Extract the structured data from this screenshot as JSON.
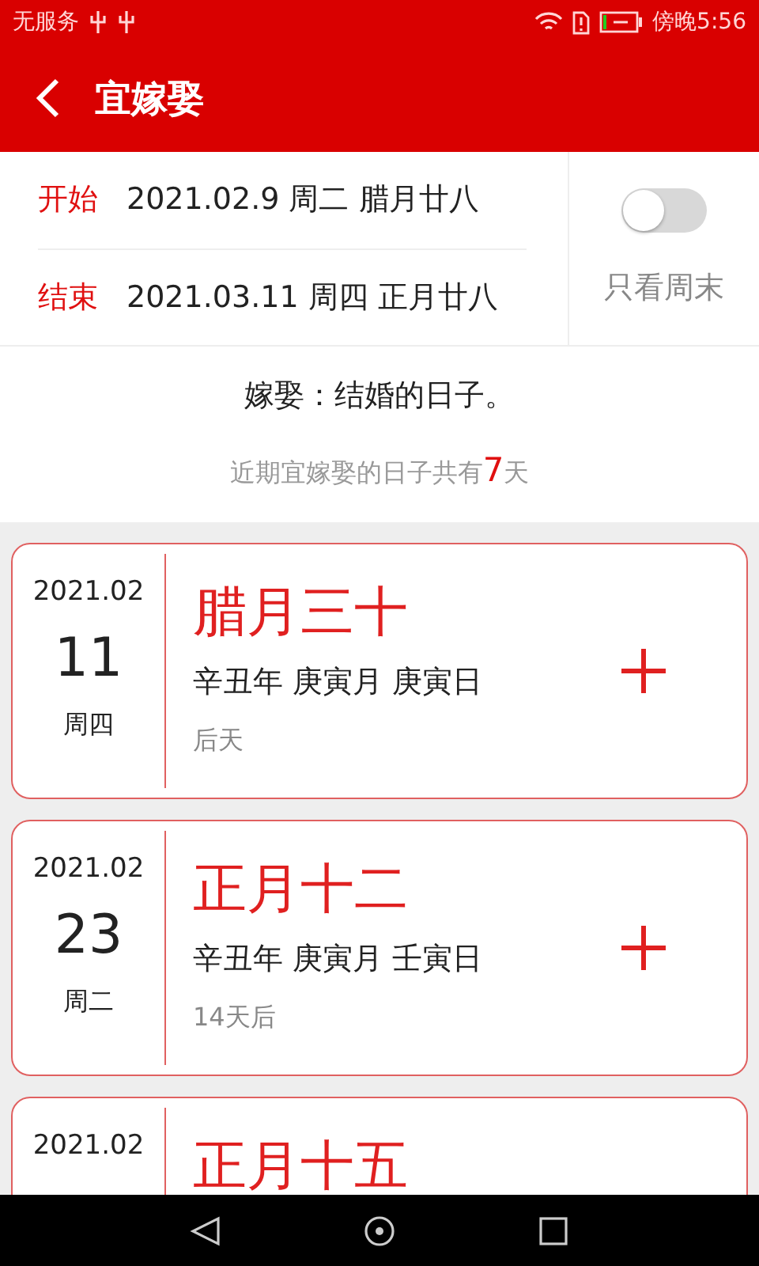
{
  "status_bar": {
    "carrier": "无服务",
    "time": "傍晚5:56"
  },
  "header": {
    "title": "宜嫁娶"
  },
  "range": {
    "start_label": "开始",
    "start_value": "2021.02.9 周二 腊月廿八",
    "end_label": "结束",
    "end_value": "2021.03.11 周四 正月廿八"
  },
  "weekend_filter": {
    "label": "只看周末",
    "on": false
  },
  "description": "嫁娶：结婚的日子。",
  "summary": {
    "prefix": "近期宜嫁娶的日子共有",
    "count": "7",
    "suffix": "天"
  },
  "days": [
    {
      "month": "2021.02",
      "day": "11",
      "weekday": "周四",
      "lunar": "腊月三十",
      "ganzhi": "辛丑年 庚寅月 庚寅日",
      "relative": "后天"
    },
    {
      "month": "2021.02",
      "day": "23",
      "weekday": "周二",
      "lunar": "正月十二",
      "ganzhi": "辛丑年 庚寅月 壬寅日",
      "relative": "14天后"
    },
    {
      "month": "2021.02",
      "lunar": "正月十五"
    }
  ]
}
